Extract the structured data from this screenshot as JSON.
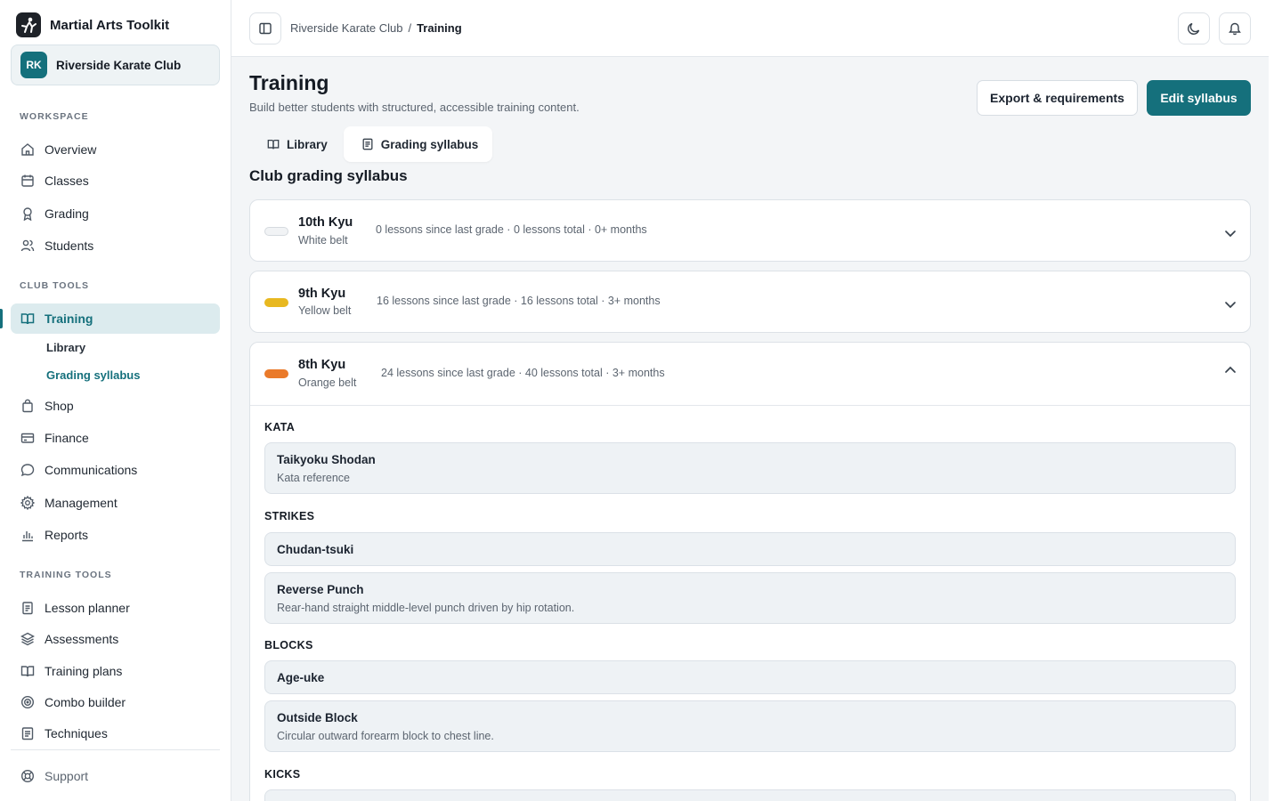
{
  "app": {
    "name": "Martial Arts Toolkit"
  },
  "club": {
    "initials": "RK",
    "name": "Riverside Karate Club"
  },
  "sidebar": {
    "workspace_label": "WORKSPACE",
    "workspace": [
      {
        "label": "Overview",
        "icon": "home-icon"
      },
      {
        "label": "Classes",
        "icon": "calendar-icon"
      },
      {
        "label": "Grading",
        "icon": "award-icon"
      },
      {
        "label": "Students",
        "icon": "users-icon"
      }
    ],
    "club_tools_label": "CLUB TOOLS",
    "training": {
      "label": "Training",
      "icon": "book-open-icon"
    },
    "training_sub": [
      {
        "label": "Library"
      },
      {
        "label": "Grading syllabus"
      }
    ],
    "club_tools": [
      {
        "label": "Shop",
        "icon": "shopping-bag-icon"
      },
      {
        "label": "Finance",
        "icon": "credit-card-icon"
      },
      {
        "label": "Communications",
        "icon": "chat-bubble-icon"
      },
      {
        "label": "Management",
        "icon": "gear-icon"
      },
      {
        "label": "Reports",
        "icon": "bar-chart-icon"
      }
    ],
    "training_tools_label": "TRAINING TOOLS",
    "training_tools": [
      {
        "label": "Lesson planner",
        "icon": "clipboard-icon"
      },
      {
        "label": "Assessments",
        "icon": "layers-icon"
      },
      {
        "label": "Training plans",
        "icon": "book-open-icon"
      },
      {
        "label": "Combo builder",
        "icon": "target-icon"
      },
      {
        "label": "Techniques",
        "icon": "document-icon"
      }
    ],
    "support": {
      "label": "Support",
      "icon": "lifebuoy-icon"
    }
  },
  "topbar": {
    "breadcrumb": [
      "Riverside Karate Club",
      "/",
      "Training"
    ]
  },
  "page": {
    "title": "Training",
    "subtitle": "Build better students with structured, accessible training content.",
    "export_label": "Export & requirements",
    "edit_label": "Edit syllabus",
    "tabs": [
      {
        "label": "Library",
        "icon": "book-open-icon"
      },
      {
        "label": "Grading syllabus",
        "icon": "document-icon",
        "selected": true
      }
    ],
    "section_title": "Club grading syllabus"
  },
  "grades": [
    {
      "name": "10th Kyu",
      "belt": "White belt",
      "belt_color": "#f1f3f5",
      "meta": "0 lessons since last grade · 0 lessons total · 0+ months",
      "expanded": false
    },
    {
      "name": "9th Kyu",
      "belt": "Yellow belt",
      "belt_color": "#e8b820",
      "meta": "16 lessons since last grade · 16 lessons total · 3+ months",
      "expanded": false
    },
    {
      "name": "8th Kyu",
      "belt": "Orange belt",
      "belt_color": "#ea7a2a",
      "meta": "24 lessons since last grade · 40 lessons total · 3+ months",
      "expanded": true,
      "categories": [
        {
          "label": "KATA",
          "items": [
            {
              "name": "Taikyoku Shodan",
              "desc": "Kata reference"
            }
          ]
        },
        {
          "label": "STRIKES",
          "items": [
            {
              "name": "Chudan-tsuki",
              "desc": ""
            },
            {
              "name": "Reverse Punch",
              "desc": "Rear-hand straight middle-level punch driven by hip rotation."
            }
          ]
        },
        {
          "label": "BLOCKS",
          "items": [
            {
              "name": "Age-uke",
              "desc": ""
            },
            {
              "name": "Outside Block",
              "desc": "Circular outward forearm block to chest line."
            }
          ]
        },
        {
          "label": "KICKS",
          "items": []
        }
      ]
    }
  ],
  "colors": {
    "accent": "#15707c",
    "accent_soft": "#dcebee",
    "page_bg": "#f3f5f7"
  }
}
